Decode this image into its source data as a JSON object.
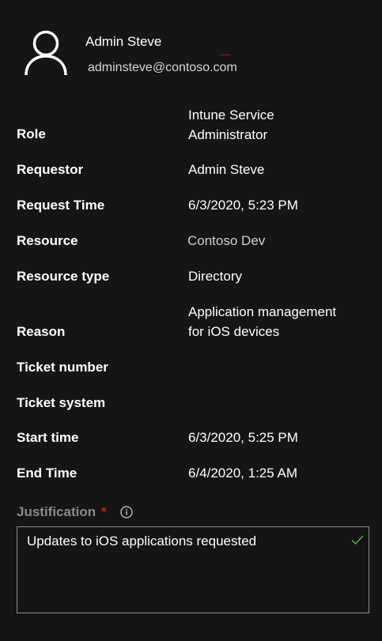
{
  "user": {
    "name": "Admin Steve",
    "email": "adminsteve@contoso.com",
    "avatar_icon": "person-icon"
  },
  "details": [
    {
      "label": "Role",
      "value": [
        "Intune Service",
        "Administrator"
      ]
    },
    {
      "label": "Requestor",
      "value": [
        "Admin Steve"
      ]
    },
    {
      "label": "Request Time",
      "value": [
        "6/3/2020, 5:23 PM"
      ]
    },
    {
      "label": "Resource",
      "value": [
        "Contoso Dev"
      ]
    },
    {
      "label": "Resource type",
      "value": [
        "Directory"
      ]
    },
    {
      "label": "Reason",
      "value": [
        "Application management",
        "for iOS devices"
      ]
    },
    {
      "label": "Ticket number",
      "value": [
        ""
      ]
    },
    {
      "label": "Ticket system",
      "value": [
        ""
      ]
    },
    {
      "label": "Start time",
      "value": [
        "6/3/2020, 5:25 PM"
      ]
    },
    {
      "label": "End Time",
      "value": [
        "6/4/2020, 1:25 AM"
      ]
    }
  ],
  "justification": {
    "label": "Justification",
    "required_marker": "*",
    "info_icon": "info-icon",
    "value": "Updates to iOS applications requested",
    "valid_icon": "checkmark-icon"
  },
  "colors": {
    "background": "#151515",
    "text": "#ffffff",
    "muted_label": "#8a8a8a",
    "required": "#e81123",
    "valid": "#5fb157"
  }
}
